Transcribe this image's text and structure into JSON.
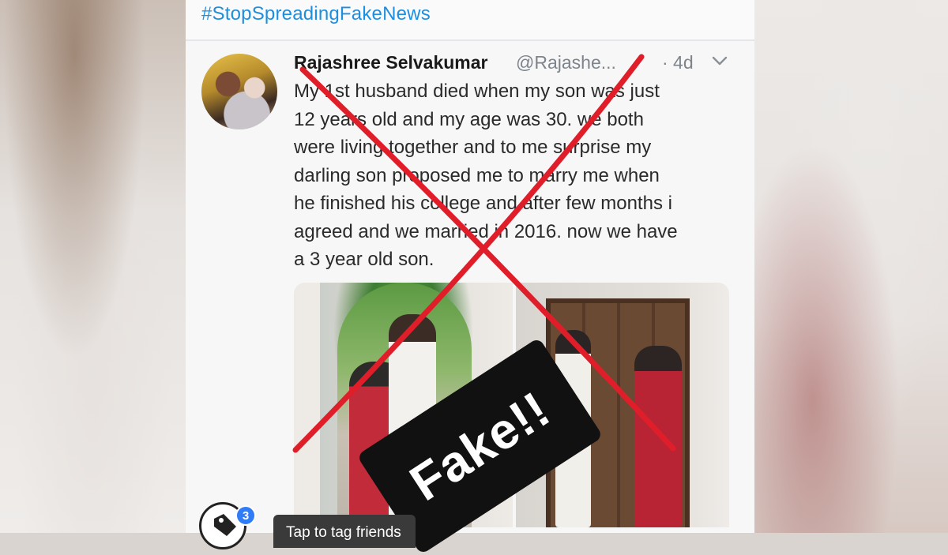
{
  "header": {
    "hashtag": "#StopSpreadingFakeNews"
  },
  "tweet": {
    "display_name": "Rajashree Selvakumar",
    "handle": "@Rajashe...",
    "time_ago": "· 4d",
    "menu_icon": "chevron-down-icon",
    "text_lines": [
      "My 1st husband died when my son was just",
      "12 years old and my age was 30. we both",
      "were living together and to me surprise my",
      "darling son proposed me to marry me when",
      "he finished his college and after few months i",
      "agreed and we married in 2016. now we have",
      "a 3 year old son."
    ]
  },
  "overlay": {
    "stamp_text": "Fake!!",
    "cross_color": "#e01e2a"
  },
  "tag_friends": {
    "badge_count": "3",
    "tooltip": "Tap to tag friends",
    "icon": "tag-icon"
  },
  "colors": {
    "link_blue": "#1d8fe0",
    "muted_gray": "#7d848b",
    "badge_blue": "#2f7cf6"
  }
}
